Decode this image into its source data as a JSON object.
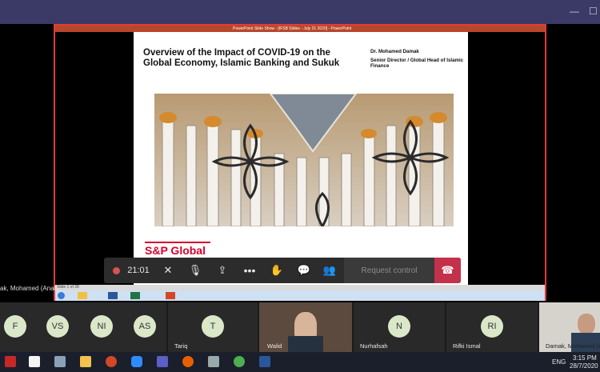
{
  "window": {
    "minimize_glyph": "—",
    "maximize_glyph": "☐"
  },
  "powerpoint": {
    "titlebar": "PowerPoint Slide Show - [IFSB Slides - July 21 2020] - PowerPoint",
    "status_left": "Slide 1 of 28"
  },
  "slide": {
    "title": "Overview of the Impact of COVID-19 on the Global Economy, Islamic Banking and Sukuk",
    "author_name": "Dr. Mohamed Damak",
    "author_role": "Senior Director / Global Head of Islamic Finance",
    "brand": "S&P Global"
  },
  "call": {
    "timer": "21:01",
    "request_control": "Request control",
    "presenter_label": "ak, Mohamed (Analy..."
  },
  "participants": [
    {
      "initials": "F",
      "name": ""
    },
    {
      "initials": "VS",
      "name": ""
    },
    {
      "initials": "NI",
      "name": ""
    },
    {
      "initials": "AS",
      "name": ""
    },
    {
      "initials": "T",
      "name": "Tariq"
    },
    {
      "initials": "",
      "name": "Walid"
    },
    {
      "initials": "N",
      "name": "Nurhafsah"
    },
    {
      "initials": "RI",
      "name": "Rifki Ismal"
    },
    {
      "initials": "",
      "name": "Damak, Mohamed (A"
    }
  ],
  "tray": {
    "lang": "ENG",
    "time": "3:15 PM",
    "date": "28/7/2020"
  },
  "colors": {
    "teams_bar": "#3b3a66",
    "share_border": "#e23b3b",
    "hangup": "#c4314b",
    "brand_red": "#d6002a"
  }
}
